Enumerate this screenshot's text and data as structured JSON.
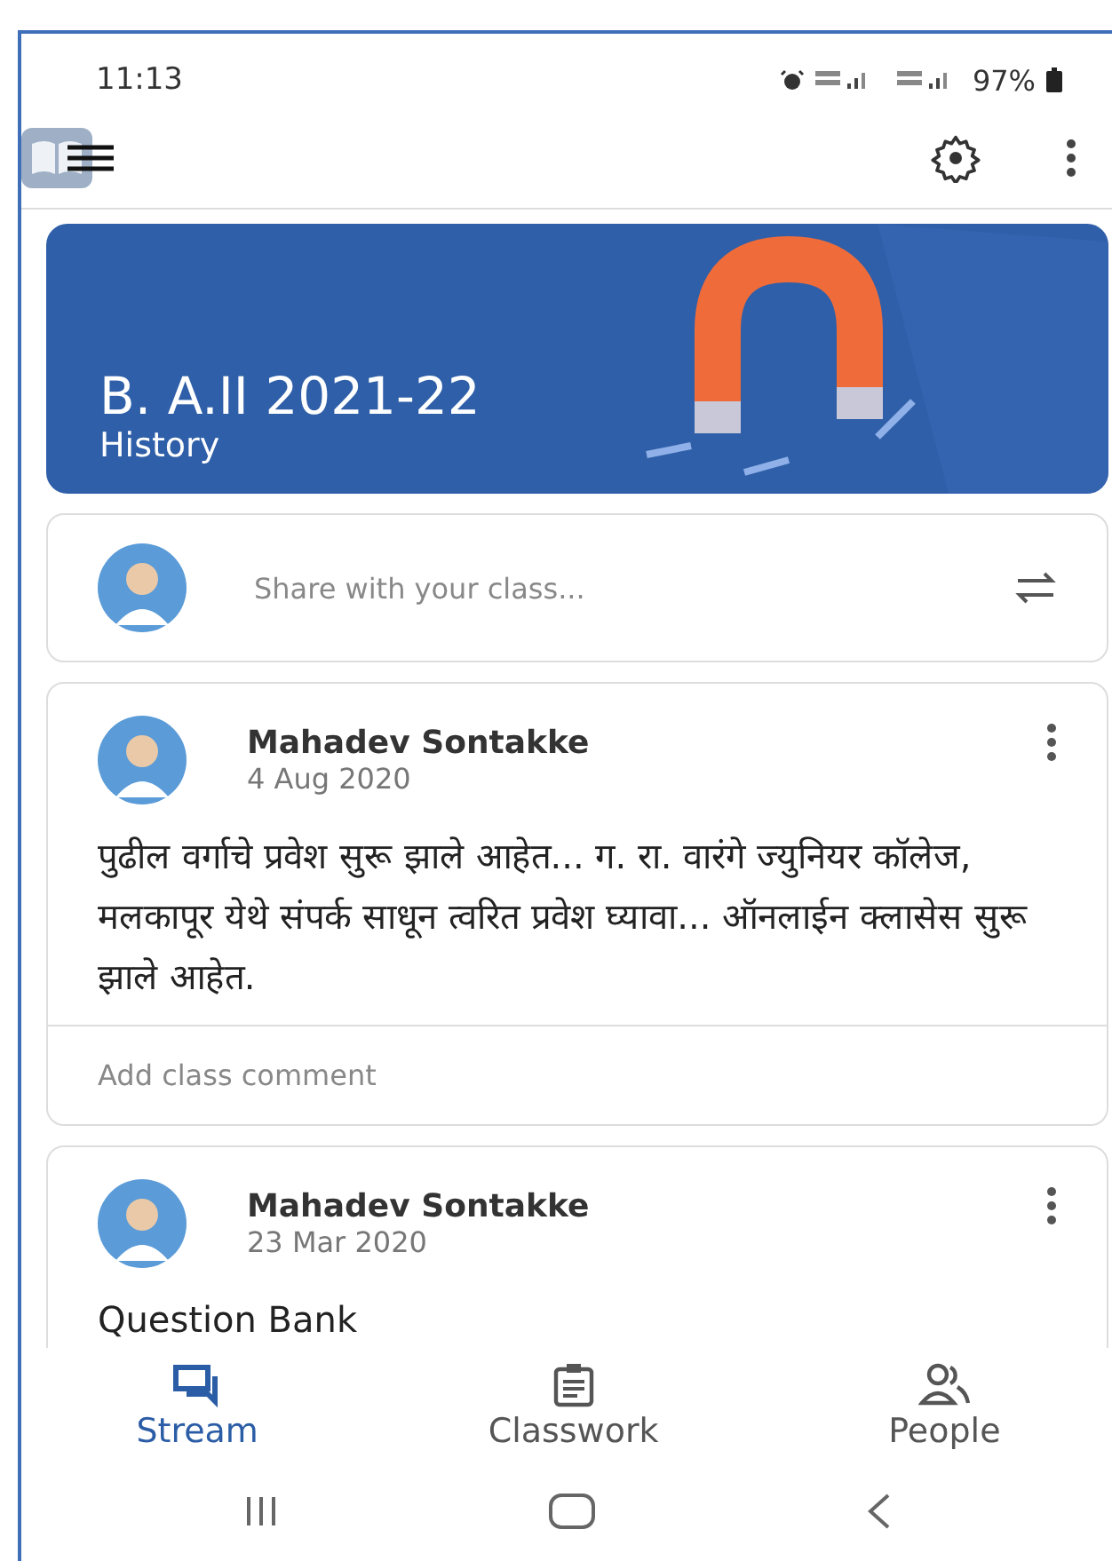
{
  "status_bar": {
    "time": "11:13",
    "battery": "97%"
  },
  "banner": {
    "title": "B. A.II 2021-22",
    "subtitle": "History"
  },
  "share": {
    "placeholder": "Share with your class..."
  },
  "posts": [
    {
      "author": "Mahadev Sontakke",
      "date": "4 Aug 2020",
      "body": "पुढील वर्गाचे प्रवेश सुरू झाले आहेत... ग. रा. वारंगे ज्युनियर कॉलेज, मलकापूर येथे संपर्क साधून त्वरित प्रवेश घ्यावा... ऑनलाईन क्लासेस सुरू झाले आहेत.",
      "comment_placeholder": "Add class comment"
    },
    {
      "author": "Mahadev Sontakke",
      "date": "23 Mar 2020",
      "body": "Question Bank"
    }
  ],
  "bottom_nav": [
    {
      "kind": "stream",
      "label": "Stream",
      "selected": true
    },
    {
      "kind": "classwork",
      "label": "Classwork",
      "selected": false
    },
    {
      "kind": "people",
      "label": "People",
      "selected": false
    }
  ]
}
